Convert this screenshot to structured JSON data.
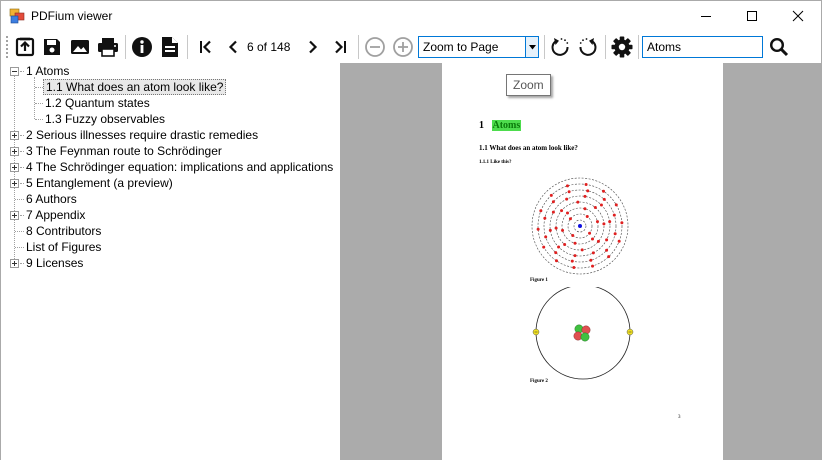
{
  "window": {
    "title": "PDFium viewer"
  },
  "toolbar": {
    "page_indicator": "6 of 148",
    "zoom_value": "Zoom to Page",
    "search_value": "Atoms",
    "buttons": [
      {
        "name": "open-file-icon"
      },
      {
        "name": "save-icon"
      },
      {
        "name": "image-icon"
      },
      {
        "name": "print-icon"
      },
      {
        "name": "info-icon"
      },
      {
        "name": "document-properties-icon"
      },
      {
        "name": "first-page-icon"
      },
      {
        "name": "previous-page-icon"
      },
      {
        "name": "next-page-icon"
      },
      {
        "name": "last-page-icon"
      },
      {
        "name": "zoom-out-icon"
      },
      {
        "name": "zoom-in-icon"
      },
      {
        "name": "rotate-left-icon"
      },
      {
        "name": "rotate-right-icon"
      },
      {
        "name": "settings-icon"
      },
      {
        "name": "search-icon"
      }
    ]
  },
  "tooltip": "Zoom",
  "tree": {
    "items": [
      {
        "label": "1 Atoms",
        "level": 0,
        "state": "expanded"
      },
      {
        "label": "1.1 What does an atom look like?",
        "level": 1,
        "state": "leaf",
        "selected": true
      },
      {
        "label": "1.2 Quantum states",
        "level": 1,
        "state": "leaf"
      },
      {
        "label": "1.3 Fuzzy observables",
        "level": 1,
        "state": "leaf"
      },
      {
        "label": "2 Serious illnesses require drastic remedies",
        "level": 0,
        "state": "collapsed"
      },
      {
        "label": "3 The Feynman route to Schrödinger",
        "level": 0,
        "state": "collapsed"
      },
      {
        "label": "4 The Schrödinger equation: implications and applications",
        "level": 0,
        "state": "collapsed"
      },
      {
        "label": "5 Entanglement (a preview)",
        "level": 0,
        "state": "collapsed"
      },
      {
        "label": "6 Authors",
        "level": 0,
        "state": "leaf"
      },
      {
        "label": "7 Appendix",
        "level": 0,
        "state": "collapsed"
      },
      {
        "label": "8 Contributors",
        "level": 0,
        "state": "leaf"
      },
      {
        "label": "List of Figures",
        "level": 0,
        "state": "leaf"
      },
      {
        "label": "9 Licenses",
        "level": 0,
        "state": "collapsed"
      }
    ]
  },
  "document_page": {
    "section_number": "1",
    "section_title": "Atoms",
    "subsection": "1.1  What does an atom look like?",
    "subsubsection": "1.1.1  Like this?",
    "figure1_caption": "Figure 1",
    "figure2_caption": "Figure 2",
    "page_number": "3"
  },
  "colors": {
    "highlight": "#4ddc4d",
    "electron": "#e02020",
    "nucleus": "#1010e0",
    "proton": "#e05050",
    "neutron": "#40c040",
    "orbit_electron": "#f0e020",
    "accent_border": "#0078d7"
  }
}
